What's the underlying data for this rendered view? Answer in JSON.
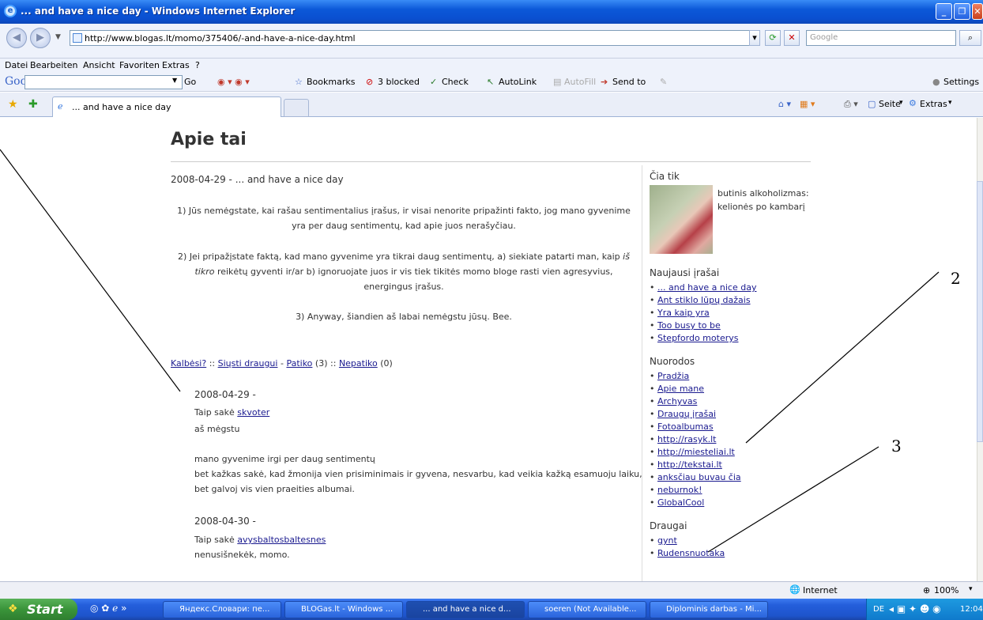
{
  "window": {
    "title": "... and have a nice day - Windows Internet Explorer"
  },
  "address": {
    "url": "http://www.blogas.lt/momo/375406/-and-have-a-nice-day.html",
    "search_placeholder": "Google"
  },
  "menu": [
    "Datei",
    "Bearbeiten",
    "Ansicht",
    "Favoriten",
    "Extras",
    "?"
  ],
  "google_toolbar": {
    "logo": "Google",
    "go": "Go",
    "bookmarks": "Bookmarks",
    "blocked": "3 blocked",
    "check": "Check",
    "autolink": "AutoLink",
    "autofill": "AutoFill",
    "sendto": "Send to",
    "settings": "Settings"
  },
  "tabs": {
    "active_label": "... and have a nice day",
    "seite": "Seite",
    "extras": "Extras"
  },
  "page": {
    "heading": "Apie tai",
    "post_title": "2008-04-29 - ... and have a nice day",
    "para1": "1) Jūs nemėgstate, kai rašau sentimentalius įrašus, ir visai nenorite pripažinti fakto, jog mano gyvenime yra per daug sentimentų, kad apie juos nerašyčiau.",
    "para2a": "2) Jei pripažįstate faktą, kad mano gyvenime yra tikrai daug sentimentų, a) siekiate patarti man, kaip ",
    "para2_em": "iš tikro",
    "para2b": " reikėtų gyventi ir/ar b) ignoruojate juos ir vis tiek tikitės momo bloge rasti vien agresyvius, energingus įrašus.",
    "para3": "3) Anyway, šiandien aš labai nemėgstu jūsų. Bee.",
    "actions": {
      "talk": "Kalbėsi?",
      "sep1": "::",
      "send": "Siųsti draugui",
      "dash": "-",
      "like": "Patiko",
      "like_count": "(3)",
      "sep2": "::",
      "dislike": "Nepatiko",
      "dislike_count": "(0)"
    },
    "comments": [
      {
        "date": "2008-04-29 -",
        "said": "Taip sakė",
        "author": "skvoter",
        "lines": [
          "aš mėgstu",
          "",
          "mano gyvenime irgi per daug sentimentų",
          "bet kažkas sakė, kad žmonija vien prisiminimais ir gyvena, nesvarbu, kad veikia kažką esamuoju laiku,",
          "bet galvoj vis vien praeities albumai."
        ]
      },
      {
        "date": "2008-04-30 -",
        "said": "Taip sakė",
        "author": "avysbaltosbaltesnes",
        "lines": [
          "nenusišnekėk, momo."
        ]
      }
    ]
  },
  "sidebar": {
    "cia_tik": {
      "title": "Čia tik",
      "text1": "butinis alkoholizmas:",
      "text2": "kelionės po kambarį"
    },
    "naujausi": {
      "title": "Naujausi įrašai",
      "items": [
        "... and have a nice day",
        "Ant stiklo lūpų dažais",
        "Yra kaip yra",
        "Too busy to be",
        "Stepfordo moterys"
      ]
    },
    "nuorodos": {
      "title": "Nuorodos",
      "items": [
        "Pradžia",
        "Apie mane",
        "Archyvas",
        "Draugų įrašai",
        "Fotoalbumas",
        "http://rasyk.lt",
        "http://miesteliai.lt",
        "http://tekstai.lt",
        "anksčiau buvau čia",
        "neburnok!",
        "GlobalCool"
      ]
    },
    "draugai": {
      "title": "Draugai",
      "items": [
        "gynt",
        "Rudensnuotaka"
      ]
    }
  },
  "annotations": [
    "2",
    "3"
  ],
  "status": {
    "zone": "Internet",
    "zoom": "100%"
  },
  "taskbar": {
    "start": "Start",
    "items": [
      "Яндекс.Словари: пе...",
      "BLOGas.lt - Windows ...",
      "... and have a nice d...",
      "soeren (Not Available...",
      "Diplominis darbas - Mi..."
    ],
    "lang": "DE",
    "clock": "12:04"
  }
}
